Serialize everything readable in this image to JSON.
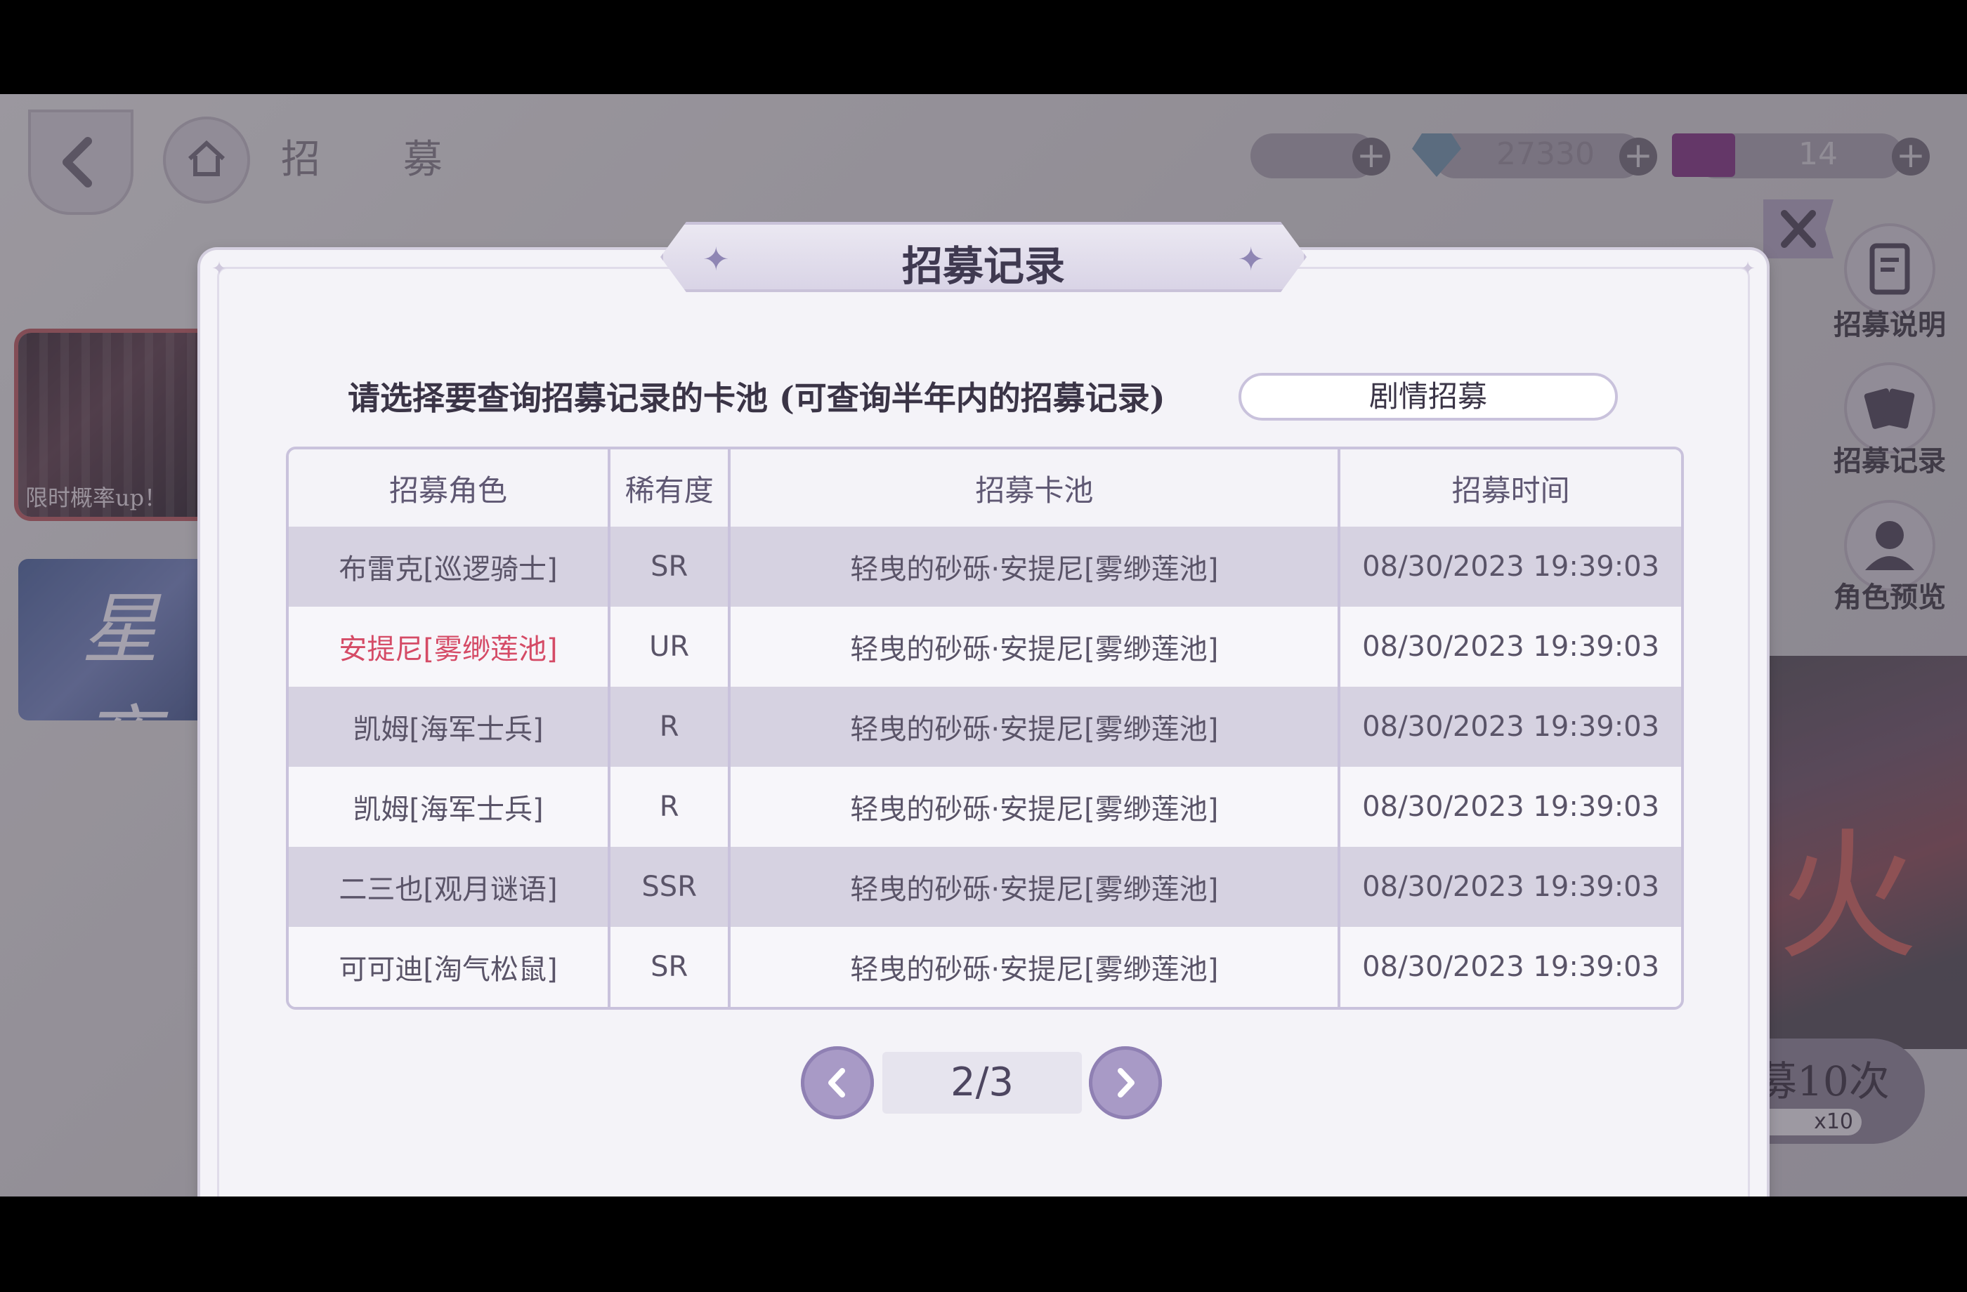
{
  "background": {
    "title": "招 募",
    "currency_gem": "27330",
    "currency_ticket": "14",
    "banner_limited_label": "限时概率up！",
    "banner_star": "星夜",
    "side_menu": [
      {
        "label": "招募说明",
        "icon": "clipboard-icon"
      },
      {
        "label": "招募记录",
        "icon": "cards-icon"
      },
      {
        "label": "角色预览",
        "icon": "person-icon"
      }
    ],
    "recruit_ten_label": "募10次",
    "recruit_ten_cost": "x10"
  },
  "modal": {
    "title": "招募记录",
    "prompt": "请选择要查询招募记录的卡池 (可查询半年内的招募记录)",
    "pool_selected": "剧情招募",
    "columns": [
      "招募角色",
      "稀有度",
      "招募卡池",
      "招募时间"
    ],
    "rows": [
      {
        "character": "布雷克[巡逻骑士]",
        "rarity": "SR",
        "pool": "轻曳的砂砾·安提尼[雾缈莲池]",
        "time": "08/30/2023 19:39:03"
      },
      {
        "character": "安提尼[雾缈莲池]",
        "rarity": "UR",
        "pool": "轻曳的砂砾·安提尼[雾缈莲池]",
        "time": "08/30/2023 19:39:03"
      },
      {
        "character": "凯姆[海军士兵]",
        "rarity": "R",
        "pool": "轻曳的砂砾·安提尼[雾缈莲池]",
        "time": "08/30/2023 19:39:03"
      },
      {
        "character": "凯姆[海军士兵]",
        "rarity": "R",
        "pool": "轻曳的砂砾·安提尼[雾缈莲池]",
        "time": "08/30/2023 19:39:03"
      },
      {
        "character": "二三也[观月谜语]",
        "rarity": "SSR",
        "pool": "轻曳的砂砾·安提尼[雾缈莲池]",
        "time": "08/30/2023 19:39:03"
      },
      {
        "character": "可可迪[淘气松鼠]",
        "rarity": "SR",
        "pool": "轻曳的砂砾·安提尼[雾缈莲池]",
        "time": "08/30/2023 19:39:03"
      }
    ],
    "page": "2/3"
  },
  "colors": {
    "accent": "#a89ac6",
    "ur": "#d54b66",
    "row_shade": "#d6d2e1"
  }
}
